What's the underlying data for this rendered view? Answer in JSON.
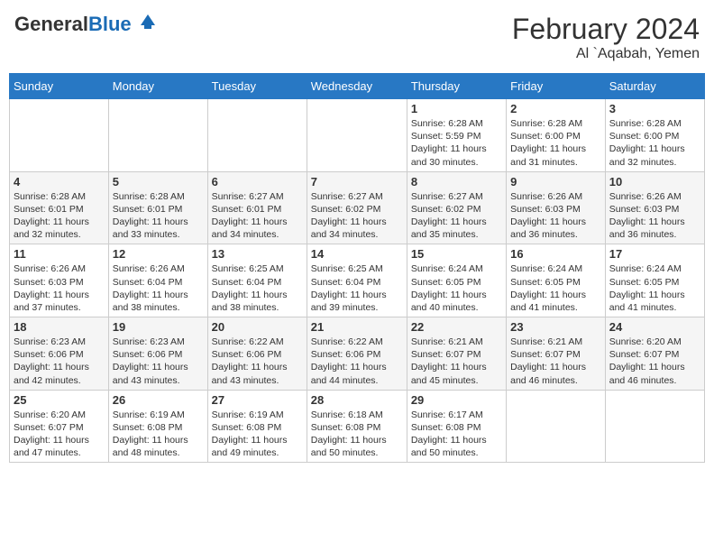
{
  "header": {
    "logo_general": "General",
    "logo_blue": "Blue",
    "month_year": "February 2024",
    "location": "Al `Aqabah, Yemen"
  },
  "days_of_week": [
    "Sunday",
    "Monday",
    "Tuesday",
    "Wednesday",
    "Thursday",
    "Friday",
    "Saturday"
  ],
  "weeks": [
    [
      {
        "day": "",
        "info": ""
      },
      {
        "day": "",
        "info": ""
      },
      {
        "day": "",
        "info": ""
      },
      {
        "day": "",
        "info": ""
      },
      {
        "day": "1",
        "info": "Sunrise: 6:28 AM\nSunset: 5:59 PM\nDaylight: 11 hours and 30 minutes."
      },
      {
        "day": "2",
        "info": "Sunrise: 6:28 AM\nSunset: 6:00 PM\nDaylight: 11 hours and 31 minutes."
      },
      {
        "day": "3",
        "info": "Sunrise: 6:28 AM\nSunset: 6:00 PM\nDaylight: 11 hours and 32 minutes."
      }
    ],
    [
      {
        "day": "4",
        "info": "Sunrise: 6:28 AM\nSunset: 6:01 PM\nDaylight: 11 hours and 32 minutes."
      },
      {
        "day": "5",
        "info": "Sunrise: 6:28 AM\nSunset: 6:01 PM\nDaylight: 11 hours and 33 minutes."
      },
      {
        "day": "6",
        "info": "Sunrise: 6:27 AM\nSunset: 6:01 PM\nDaylight: 11 hours and 34 minutes."
      },
      {
        "day": "7",
        "info": "Sunrise: 6:27 AM\nSunset: 6:02 PM\nDaylight: 11 hours and 34 minutes."
      },
      {
        "day": "8",
        "info": "Sunrise: 6:27 AM\nSunset: 6:02 PM\nDaylight: 11 hours and 35 minutes."
      },
      {
        "day": "9",
        "info": "Sunrise: 6:26 AM\nSunset: 6:03 PM\nDaylight: 11 hours and 36 minutes."
      },
      {
        "day": "10",
        "info": "Sunrise: 6:26 AM\nSunset: 6:03 PM\nDaylight: 11 hours and 36 minutes."
      }
    ],
    [
      {
        "day": "11",
        "info": "Sunrise: 6:26 AM\nSunset: 6:03 PM\nDaylight: 11 hours and 37 minutes."
      },
      {
        "day": "12",
        "info": "Sunrise: 6:26 AM\nSunset: 6:04 PM\nDaylight: 11 hours and 38 minutes."
      },
      {
        "day": "13",
        "info": "Sunrise: 6:25 AM\nSunset: 6:04 PM\nDaylight: 11 hours and 38 minutes."
      },
      {
        "day": "14",
        "info": "Sunrise: 6:25 AM\nSunset: 6:04 PM\nDaylight: 11 hours and 39 minutes."
      },
      {
        "day": "15",
        "info": "Sunrise: 6:24 AM\nSunset: 6:05 PM\nDaylight: 11 hours and 40 minutes."
      },
      {
        "day": "16",
        "info": "Sunrise: 6:24 AM\nSunset: 6:05 PM\nDaylight: 11 hours and 41 minutes."
      },
      {
        "day": "17",
        "info": "Sunrise: 6:24 AM\nSunset: 6:05 PM\nDaylight: 11 hours and 41 minutes."
      }
    ],
    [
      {
        "day": "18",
        "info": "Sunrise: 6:23 AM\nSunset: 6:06 PM\nDaylight: 11 hours and 42 minutes."
      },
      {
        "day": "19",
        "info": "Sunrise: 6:23 AM\nSunset: 6:06 PM\nDaylight: 11 hours and 43 minutes."
      },
      {
        "day": "20",
        "info": "Sunrise: 6:22 AM\nSunset: 6:06 PM\nDaylight: 11 hours and 43 minutes."
      },
      {
        "day": "21",
        "info": "Sunrise: 6:22 AM\nSunset: 6:06 PM\nDaylight: 11 hours and 44 minutes."
      },
      {
        "day": "22",
        "info": "Sunrise: 6:21 AM\nSunset: 6:07 PM\nDaylight: 11 hours and 45 minutes."
      },
      {
        "day": "23",
        "info": "Sunrise: 6:21 AM\nSunset: 6:07 PM\nDaylight: 11 hours and 46 minutes."
      },
      {
        "day": "24",
        "info": "Sunrise: 6:20 AM\nSunset: 6:07 PM\nDaylight: 11 hours and 46 minutes."
      }
    ],
    [
      {
        "day": "25",
        "info": "Sunrise: 6:20 AM\nSunset: 6:07 PM\nDaylight: 11 hours and 47 minutes."
      },
      {
        "day": "26",
        "info": "Sunrise: 6:19 AM\nSunset: 6:08 PM\nDaylight: 11 hours and 48 minutes."
      },
      {
        "day": "27",
        "info": "Sunrise: 6:19 AM\nSunset: 6:08 PM\nDaylight: 11 hours and 49 minutes."
      },
      {
        "day": "28",
        "info": "Sunrise: 6:18 AM\nSunset: 6:08 PM\nDaylight: 11 hours and 50 minutes."
      },
      {
        "day": "29",
        "info": "Sunrise: 6:17 AM\nSunset: 6:08 PM\nDaylight: 11 hours and 50 minutes."
      },
      {
        "day": "",
        "info": ""
      },
      {
        "day": "",
        "info": ""
      }
    ]
  ]
}
